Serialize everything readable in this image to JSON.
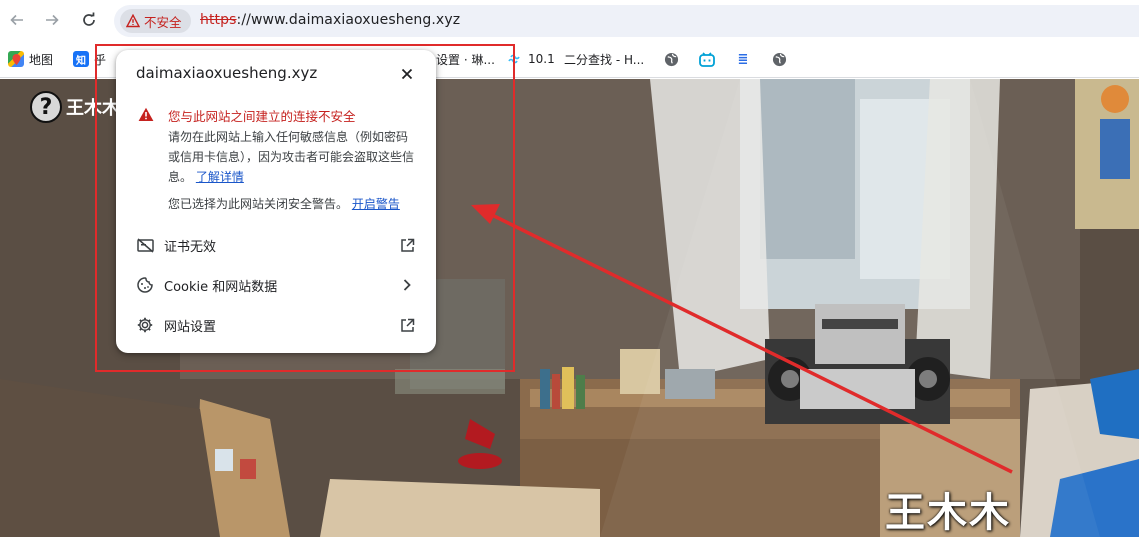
{
  "browser": {
    "back_icon": "arrow-left-icon",
    "forward_icon": "arrow-right-icon",
    "reload_icon": "reload-icon",
    "security_chip": "不安全",
    "url_scheme": "https",
    "url_rest": "://www.daimaxiaoxuesheng.xyz"
  },
  "bookmarks": [
    {
      "label": "地图",
      "icon": "maps-icon"
    },
    {
      "label": "知",
      "icon": "zhihu-icon"
    },
    {
      "label": "设置 · 琳...",
      "icon": "page-icon"
    },
    {
      "label": "10.1",
      "icon": "tailwind-icon"
    },
    {
      "label": "二分查找 - H...",
      "icon": "page-icon"
    },
    {
      "label": "",
      "icon": "globe-icon"
    },
    {
      "label": "",
      "icon": "bilibili-icon"
    },
    {
      "label": "",
      "icon": "doc-icon"
    },
    {
      "label": "",
      "icon": "globe-icon"
    }
  ],
  "site": {
    "logo_name": "王木木"
  },
  "popup": {
    "domain": "daimaxiaoxuesheng.xyz",
    "warning_title": "您与此网站之间建立的连接不安全",
    "warning_body": "请勿在此网站上输入任何敏感信息（例如密码或信用卡信息），因为攻击者可能会盗取这些信息。",
    "learn_more": "了解详情",
    "disabled_text": "您已选择为此网站关闭安全警告。",
    "enable_warnings": "开启警告",
    "rows": [
      {
        "label": "证书无效",
        "icon": "certificate-invalid-icon",
        "trailing": "open-external-icon"
      },
      {
        "label": "Cookie 和网站数据",
        "icon": "cookie-icon",
        "trailing": "chevron-right-icon"
      },
      {
        "label": "网站设置",
        "icon": "gear-icon",
        "trailing": "open-external-icon"
      }
    ]
  },
  "annotation": {
    "caption": "王木木",
    "color": "#e02b2b"
  }
}
